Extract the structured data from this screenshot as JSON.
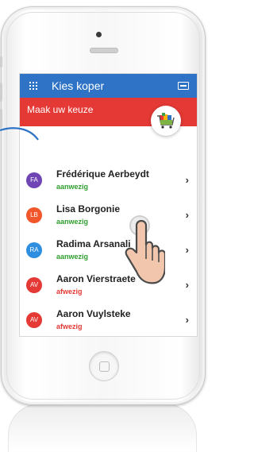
{
  "appbar": {
    "title": "Kies koper",
    "menu_icon": "grid-icon",
    "keyboard_icon": "keyboard-icon",
    "color": "#2e73c6"
  },
  "banner": {
    "text": "Maak uw keuze",
    "color": "#e53935",
    "badge_icon": "shopping-cart-icon"
  },
  "buyers": [
    {
      "initials": "FA",
      "name": "Frédérique Aerbeydt",
      "status": "aanwezig",
      "avatar_color": "#6f45b5",
      "status_color": "#2e9e2e"
    },
    {
      "initials": "LB",
      "name": "Lisa Borgonie",
      "status": "aanwezig",
      "avatar_color": "#f2572b",
      "status_color": "#2e9e2e"
    },
    {
      "initials": "RA",
      "name": "Radima Arsanali",
      "status": "aanwezig",
      "avatar_color": "#2e8fe0",
      "status_color": "#2e9e2e"
    },
    {
      "initials": "AV",
      "name": "Aaron Vierstraete",
      "status": "afwezig",
      "avatar_color": "#e53935",
      "status_color": "#e53935"
    },
    {
      "initials": "AV",
      "name": "Aaron Vuylsteke",
      "status": "afwezig",
      "avatar_color": "#e53935",
      "status_color": "#e53935"
    }
  ],
  "overlay": {
    "gesture_icon": "tap-hand-icon"
  }
}
